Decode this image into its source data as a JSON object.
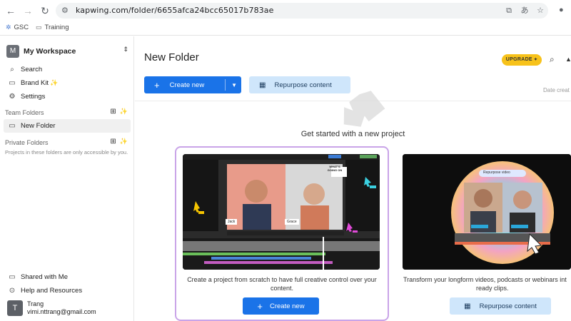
{
  "browser": {
    "url": "kapwing.com/folder/6655afca24bcc65017b783ae",
    "bookmarks": [
      {
        "label": "GSC"
      },
      {
        "label": "Training"
      }
    ]
  },
  "sidebar": {
    "workspace": {
      "avatar": "M",
      "name": "My Workspace"
    },
    "items": [
      {
        "label": "Search"
      },
      {
        "label": "Brand Kit"
      },
      {
        "label": "Settings"
      }
    ],
    "team_folders_label": "Team Folders",
    "team_folder": {
      "label": "New Folder"
    },
    "private_folders_label": "Private Folders",
    "private_note": "Projects in these folders are only accessible by you.",
    "bottom_items": [
      {
        "label": "Shared with Me"
      },
      {
        "label": "Help and Resources"
      }
    ],
    "user": {
      "avatar": "T",
      "name": "Trang",
      "email": "vimi.nttrang@gmail.com"
    }
  },
  "main": {
    "title": "New Folder",
    "upgrade_label": "UPGRADE",
    "create_new_label": "Create new",
    "repurpose_label": "Repurpose content",
    "date_column_label": "Date creat",
    "get_started_heading": "Get started with a new project",
    "card1": {
      "description": "Create a project from scratch to have full creative control over your content.",
      "button_label": "Create new",
      "names": [
        "Jack",
        "Grace"
      ],
      "bubble_text": "WHAT'S GOING ON"
    },
    "card2": {
      "description": "Transform your longform videos, podcasts or webinars int",
      "description_line2": "ready clips.",
      "button_label": "Repurpose content",
      "pill_text": "Repurpose video"
    }
  },
  "colors": {
    "primary": "#1a73e8",
    "secondary": "#cfe6fb",
    "upgrade": "#f7c21a",
    "card_border": "#c9a4e8"
  }
}
